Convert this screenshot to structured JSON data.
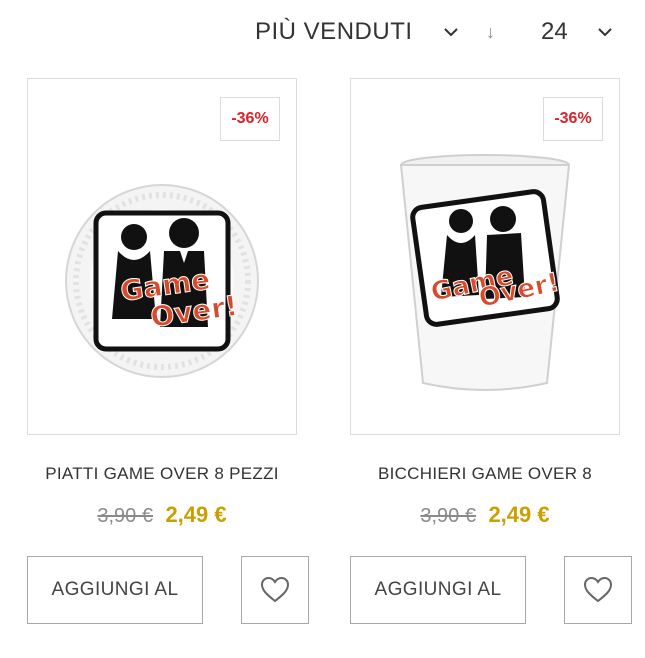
{
  "toolbar": {
    "sort_label": "PIÙ VENDUTI",
    "sort_direction_symbol": "↓",
    "per_page_value": "24"
  },
  "products": [
    {
      "title": "PIATTI GAME OVER 8 PEZZI",
      "discount": "-36%",
      "old_price": "3,90 €",
      "new_price": "2,49 €",
      "add_label": "AGGIUNGI AL",
      "art_text_1": "Game",
      "art_text_2": "Over!"
    },
    {
      "title": "BICCHIERI GAME OVER 8",
      "discount": "-36%",
      "old_price": "3,90 €",
      "new_price": "2,49 €",
      "add_label": "AGGIUNGI AL",
      "art_text_1": "Game",
      "art_text_2": "Over!"
    }
  ],
  "colors": {
    "discount": "#d8232a",
    "sale_price": "#c9a000",
    "old_price": "#8a8a8a",
    "border": "#dcdcdc"
  }
}
